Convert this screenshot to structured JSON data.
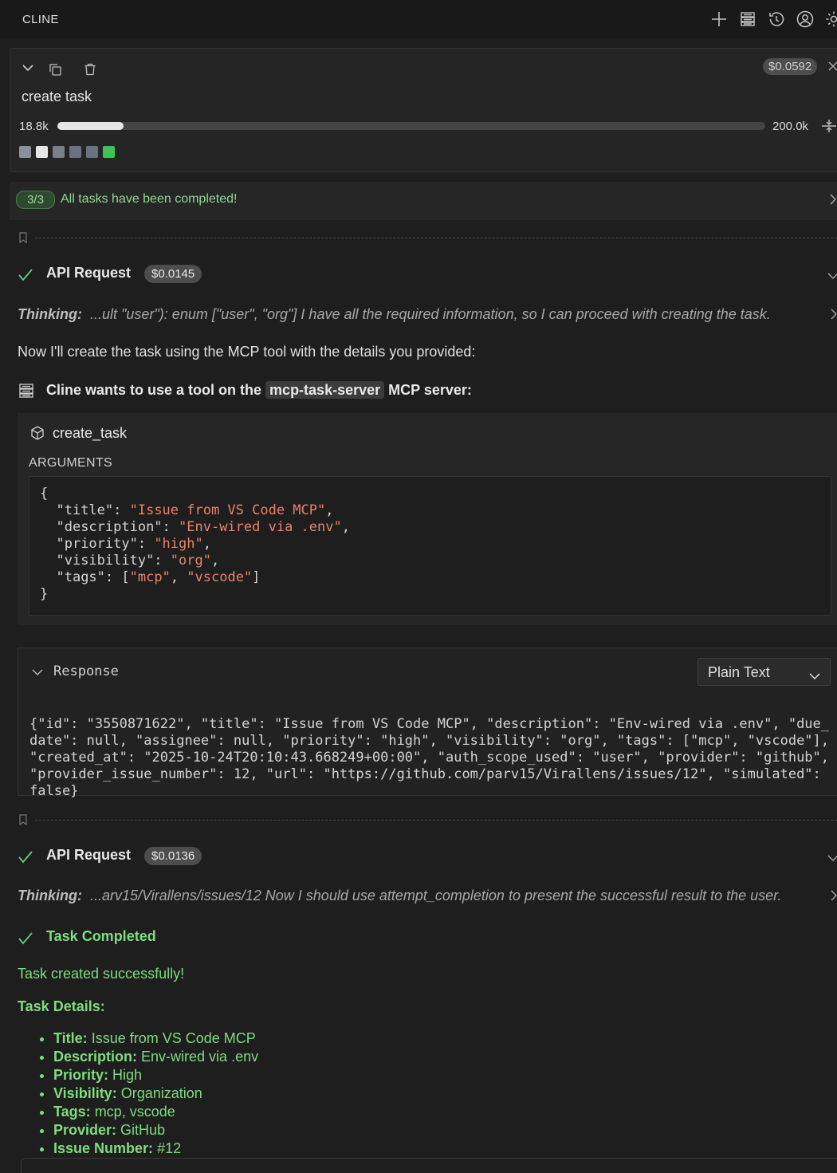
{
  "header": {
    "title": "CLINE",
    "icons": [
      "plus-icon",
      "server-icon",
      "history-icon",
      "account-icon",
      "settings-icon"
    ]
  },
  "task": {
    "title": "create task",
    "cost": "$0.0592",
    "tokens_used": "18.8k",
    "context_window": "200.0k",
    "context_fraction": 0.094,
    "step_colors": [
      "#8a919c",
      "#e6e6e6",
      "#7a808a",
      "#6b7180",
      "#6b7180",
      "#3fc25a"
    ]
  },
  "banner": {
    "count": "3/3",
    "text": "All tasks have been completed!"
  },
  "request1": {
    "label": "API Request",
    "cost": "$0.0145",
    "thinking_label": "Thinking:",
    "thinking_text": "...ult \"user\"): enum [\"user\", \"org\"] I have all the required information, so I can proceed with creating the task."
  },
  "message1": "Now I'll create the task using the MCP tool with the details you provided:",
  "tool": {
    "prefix": "Cline wants to use a tool on the",
    "server": "mcp-task-server",
    "suffix": "MCP server:",
    "name": "create_task",
    "args_label": "ARGUMENTS",
    "args": {
      "open": "{",
      "close": "}",
      "title_key": "\"title\": ",
      "title_val": "\"Issue from VS Code MCP\"",
      "desc_key": "\"description\": ",
      "desc_val": "\"Env-wired via .env\"",
      "prio_key": "\"priority\": ",
      "prio_val": "\"high\"",
      "vis_key": "\"visibility\": ",
      "vis_val": "\"org\"",
      "tags_key": "\"tags\": [",
      "tag1": "\"mcp\"",
      "tag_sep": ", ",
      "tag2": "\"vscode\"",
      "tags_end": "]",
      "comma": ","
    }
  },
  "response": {
    "label": "Response",
    "format": "Plain Text",
    "body": "{\"id\": \"3550871622\", \"title\": \"Issue from VS Code MCP\", \"description\": \"Env-wired via .env\", \"due_date\": null, \"assignee\": null, \"priority\": \"high\", \"visibility\": \"org\", \"tags\": [\"mcp\", \"vscode\"], \"created_at\": \"2025-10-24T20:10:43.668249+00:00\", \"auth_scope_used\": \"user\", \"provider\": \"github\", \"provider_issue_number\": 12, \"url\": \"https://github.com/parv15/Virallens/issues/12\", \"simulated\": false}"
  },
  "request2": {
    "label": "API Request",
    "cost": "$0.0136",
    "thinking_label": "Thinking:",
    "thinking_text": "...arv15/Virallens/issues/12 Now I should use attempt_completion to present the successful result to the user."
  },
  "completion": {
    "label": "Task Completed",
    "message": "Task created successfully!",
    "details_heading": "Task Details:",
    "details": [
      {
        "key": "Title:",
        "value": "Issue from VS Code MCP"
      },
      {
        "key": "Description:",
        "value": "Env-wired via .env"
      },
      {
        "key": "Priority:",
        "value": "High"
      },
      {
        "key": "Visibility:",
        "value": "Organization"
      },
      {
        "key": "Tags:",
        "value": "mcp, vscode"
      },
      {
        "key": "Provider:",
        "value": "GitHub"
      },
      {
        "key": "Issue Number:",
        "value": "#12"
      }
    ]
  }
}
